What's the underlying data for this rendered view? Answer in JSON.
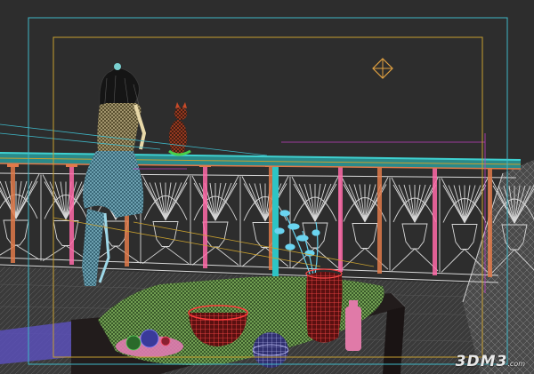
{
  "viewport": {
    "view": "3ds-max-style-wireframe-camera-view",
    "background_color": "#2d2d2d",
    "wire_colors": {
      "railing": "#d8d8d8",
      "handrail": "#2ec4c4",
      "posts": "#e07a4a",
      "figure": "#9ed8e8",
      "cat": "#c84a28",
      "vase": "#ff4a4a",
      "bowl": "#ff3a3a",
      "cloth": "#a8e27a",
      "plant": "#6ad4f0",
      "bottle": "#ff6aa8",
      "sphere": "#c8c8ff",
      "table": "#3a3030",
      "safe_frame_outer": "#3fb8c8",
      "safe_frame_inner": "#c8a030"
    },
    "icons": {
      "light": "target-light-icon"
    }
  },
  "watermark": {
    "text": "3DM3",
    "suffix": ".com"
  }
}
